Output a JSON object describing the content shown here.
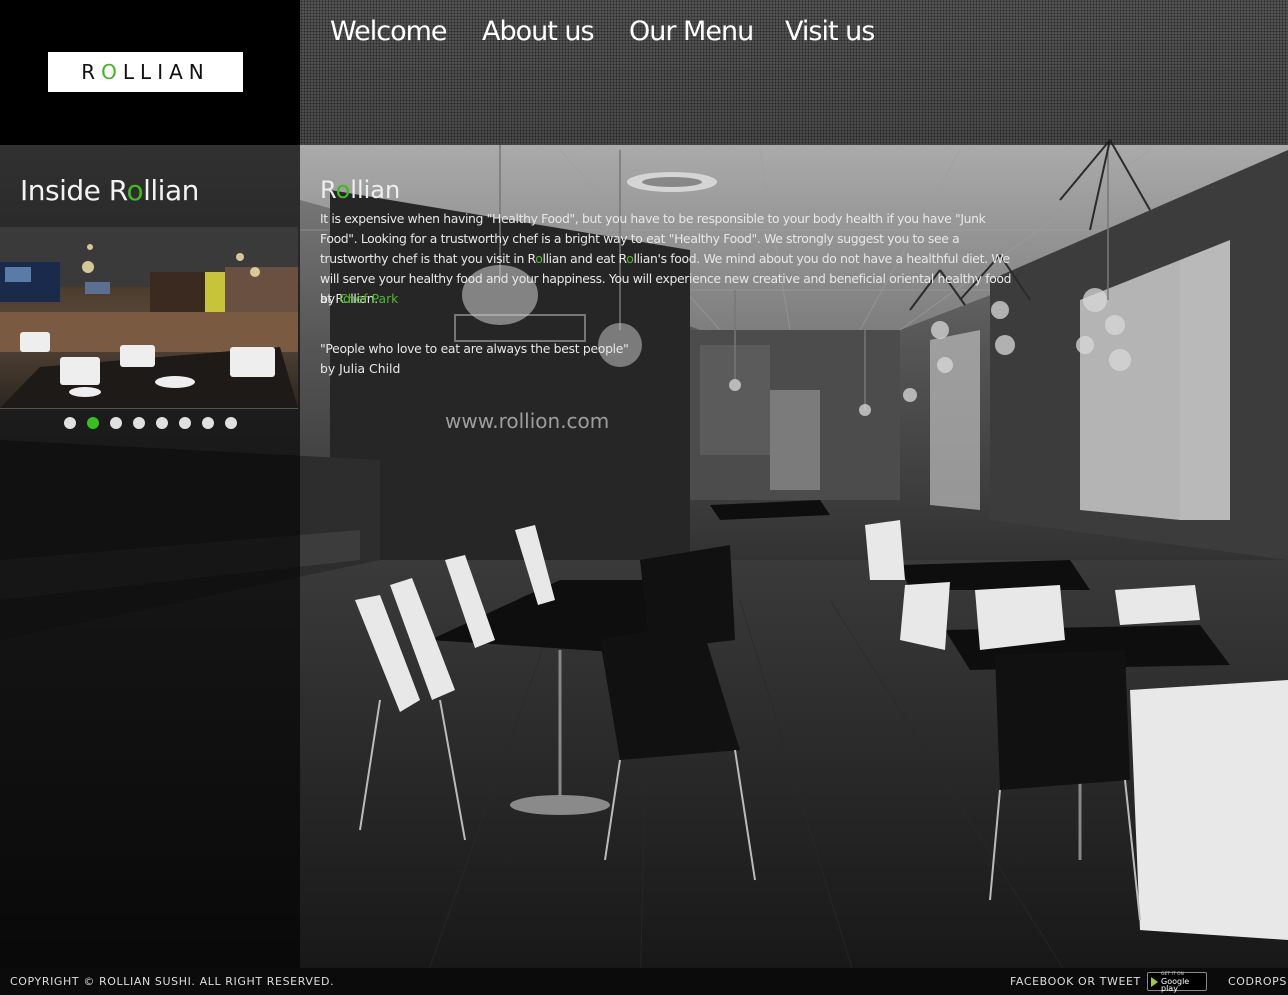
{
  "brand": {
    "logo_prefix": "R",
    "logo_o": "O",
    "logo_suffix": "LLIAN"
  },
  "nav": {
    "items": [
      {
        "label": "Welcome"
      },
      {
        "label": "About us"
      },
      {
        "label": "Our Menu"
      },
      {
        "label": "Visit us"
      }
    ]
  },
  "sidebar": {
    "title_prefix": "Inside R",
    "title_o": "o",
    "title_suffix": "llian",
    "slider": {
      "total_slides": 8,
      "active_slide": 2
    }
  },
  "content": {
    "title_prefix": "R",
    "title_o": "o",
    "title_suffix": "llian",
    "para_1": "It is expensive when having \"Healthy Food\", but you have to be responsible to your body health if you have \"Junk Food\". Looking for a trustworthy chef is a bright way to eat \"Healthy Food\". We strongly suggest you to see a trustworthy chef is that you visit in R",
    "para_o1": "o",
    "para_2": "llian and eat R",
    "para_o2": "o",
    "para_3": "llian's food. We mind about you do not have a healthful diet. We will serve your healthy food and your happiness. You will experience new creative and beneficial oriental healthy food at R",
    "para_o3": "o",
    "para_4": "llian.",
    "byline_prefix": "by ",
    "byline_name": "Chef Park",
    "quote": "\"People who love to eat are always the best people\"",
    "quote_by": "by Julia Child"
  },
  "footer": {
    "copyright": "COPYRIGHT © ROLLIAN SUSHI. ALL RIGHT RESERVED.",
    "social": "FACEBOOK OR TWEET",
    "store_badge_top": "GET IT ON",
    "store_badge_bottom": "Google play",
    "codrops": "CODROPS"
  },
  "colors": {
    "accent_green": "#43b81f",
    "active_dot": "#37c01e",
    "panel": "#000000"
  }
}
